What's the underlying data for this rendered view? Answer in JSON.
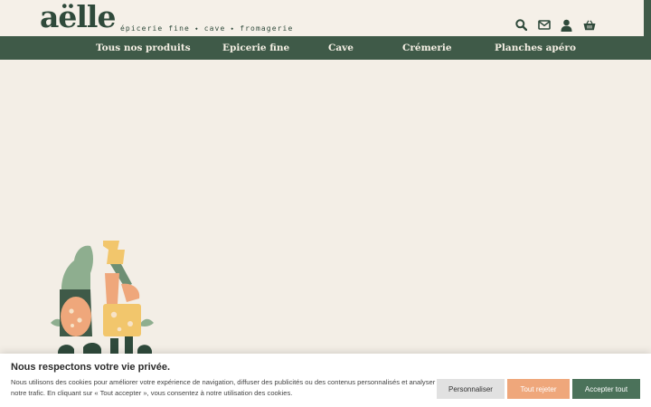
{
  "brand": {
    "logo": "aëlle",
    "tagline": "épicerie fine ⬩ cave ⬩ fromagerie"
  },
  "header_icons": [
    "search-icon",
    "mail-icon",
    "user-icon",
    "cart-icon"
  ],
  "nav": {
    "items": [
      "Tous nos produits",
      "Epicerie fine",
      "Cave",
      "Crémerie",
      "Planches apéro"
    ]
  },
  "cookie": {
    "title": "Nous respectons votre vie privée.",
    "text": "Nous utilisons des cookies pour améliorer votre expérience de navigation, diffuser des publicités ou des contenus personnalisés et analyser notre trafic. En cliquant sur « Tout accepter », vous consentez à notre utilisation des cookies.",
    "btn_customize": "Personnaliser",
    "btn_reject": "Tout rejeter",
    "btn_accept": "Accepter tout"
  },
  "colors": {
    "brand_green": "#3f5a48",
    "background": "#f3eee6",
    "accent_orange": "#efa77b",
    "accept_green": "#4b725a"
  }
}
